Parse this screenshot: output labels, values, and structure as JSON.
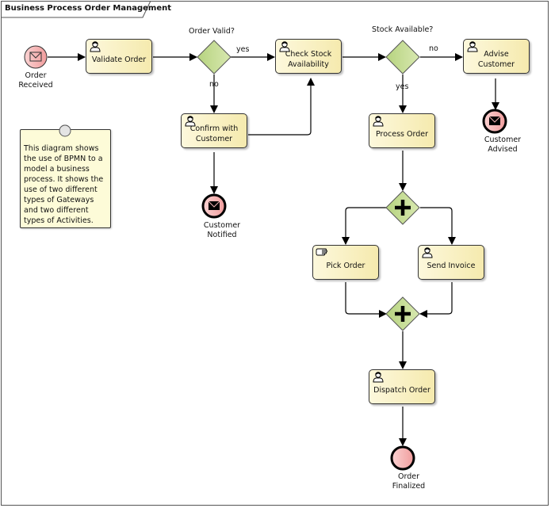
{
  "diagram": {
    "title": "Business Process Order Management",
    "note": "This diagram shows the use of BPMN to a model a business process. It shows the use of two different types of Gateways and two different types of Activities.",
    "events": {
      "order_received": {
        "line1": "Order",
        "line2": "Received"
      },
      "customer_notified": {
        "line1": "Customer",
        "line2": "Notified"
      },
      "customer_advised": {
        "line1": "Customer",
        "line2": "Advised"
      },
      "order_finalized": {
        "line1": "Order",
        "line2": "Finalized"
      }
    },
    "tasks": {
      "validate_order": "Validate Order",
      "check_stock": {
        "line1": "Check Stock",
        "line2": "Availability"
      },
      "confirm_customer": {
        "line1": "Confirm with",
        "line2": "Customer"
      },
      "advise_customer": {
        "line1": "Advise",
        "line2": "Customer"
      },
      "process_order": "Process Order",
      "pick_order": "Pick Order",
      "send_invoice": "Send Invoice",
      "dispatch_order": "Dispatch Order"
    },
    "gateways": {
      "order_valid": "Order Valid?",
      "stock_available": "Stock Available?"
    },
    "flow_labels": {
      "order_valid_yes": "yes",
      "order_valid_no": "no",
      "stock_no": "no",
      "stock_yes": "yes"
    },
    "colors": {
      "gateway_fill": "#c5dc94",
      "event_fill": "#f4b6b6",
      "task_fill": "#f5eaae",
      "note_fill": "#fdfbd8"
    }
  }
}
